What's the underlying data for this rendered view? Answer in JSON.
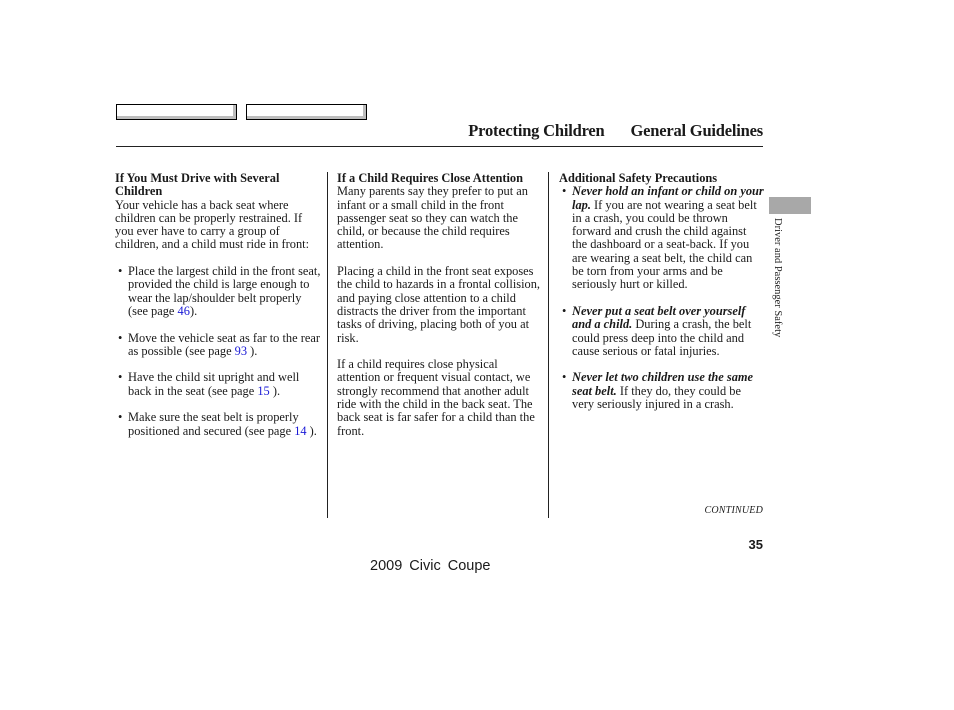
{
  "nav_boxes": [
    "",
    ""
  ],
  "header": {
    "section": "Protecting Children",
    "subsection": "General Guidelines"
  },
  "side_tab": {
    "label": "Driver and Passenger Safety",
    "color": "#a8a8a8"
  },
  "col1": {
    "heading": "If You Must Drive with Several Children",
    "intro": "Your vehicle has a back seat where children can be properly restrained. If you ever have to carry a group of children, and a child must ride in front:",
    "bullets": [
      {
        "text": "Place the largest child in the front seat, provided the child is large enough to wear the lap/shoulder belt properly (see page ",
        "page": "46",
        "after": ")."
      },
      {
        "text": "Move the vehicle seat as far to the rear as possible (see page ",
        "page": "93",
        "after": " )."
      },
      {
        "text": "Have the child sit upright and well back in the seat (see page ",
        "page": "15",
        "after": " )."
      },
      {
        "text": "Make sure the seat belt is properly positioned and secured (see page ",
        "page": "14",
        "after": " )."
      }
    ]
  },
  "col2": {
    "heading": "If a Child Requires Close Attention",
    "paragraphs": [
      "Many parents say they prefer to put an infant or a small child in the front passenger seat so they can watch the child, or because the child requires attention.",
      "Placing a child in the front seat exposes the child to hazards in a frontal collision, and paying close attention to a child distracts the driver from the important tasks of driving, placing both of you at risk.",
      "If a child requires close physical attention or frequent visual contact, we strongly recommend that another adult ride with the child in the back seat. The back seat is far safer for a child than the front."
    ]
  },
  "col3": {
    "heading": "Additional Safety Precautions",
    "bullets": [
      {
        "bold": "Never hold an infant or child on your lap.",
        "text": " If you are not wearing a seat belt in a crash, you could be thrown forward and crush the child against the dashboard or a seat-back. If you are wearing a seat belt, the child can be torn from your arms and be seriously hurt or killed."
      },
      {
        "bold": "Never put a seat belt over yourself and a child.",
        "text": " During a crash, the belt could press deep into the child and cause serious or fatal injuries."
      },
      {
        "bold": "Never let two children use the same seat belt.",
        "text": " If they do, they could be very seriously injured in a crash."
      }
    ]
  },
  "continued": "CONTINUED",
  "page_number": "35",
  "footer": "2009  Civic  Coupe",
  "colors": {
    "link": "#1a1ad6",
    "text": "#1a1a1a"
  }
}
